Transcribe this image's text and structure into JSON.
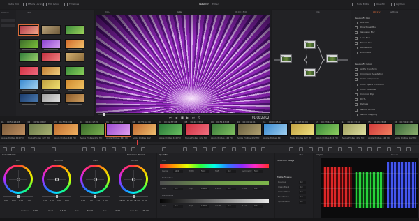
{
  "topbar": {
    "left_menu": [
      "Media Pool",
      "Effects Library",
      "Edit Index",
      "Timelines"
    ],
    "project_title": "Nature",
    "project_status": "Edited",
    "right_menu": [
      "Node Editor",
      "OpenFX",
      "Lightbox"
    ]
  },
  "gallery": {
    "label": "Gallery",
    "stills_label": "Stills"
  },
  "viewer": {
    "zoom": "34%",
    "name": "Color",
    "top_timecode": "01:00:15:08",
    "current_timecode": "01:00:23:02"
  },
  "nodes": {
    "mode_label": "Clip",
    "labels": [
      "01",
      "02",
      "03",
      "04"
    ]
  },
  "library": {
    "tab_label": "Library",
    "settings_label": "Settings",
    "section1_title": "ResolveFX Blur",
    "section1_items": [
      "Box Blur",
      "Directional Blur",
      "Gaussian Blur",
      "Lens Blur",
      "Mosaic Blur",
      "Radial Blur",
      "Zoom Blur"
    ],
    "section2_title": "ResolveFX Color",
    "section2_items": [
      "ACES Transform",
      "Chromatic Adaptation",
      "Color Compressor",
      "Color Space Transform",
      "Color Stabilizer",
      "Contrast Pop",
      "DCTL",
      "Dehaze",
      "Gamut Limiter",
      "Gamut Mapping"
    ]
  },
  "timeline": {
    "clips": [
      {
        "num": "01",
        "tc": "00:50:24:18",
        "name": "Apple ProRes 422 HQ"
      },
      {
        "num": "02",
        "tc": "00:51:08:02",
        "name": "Apple ProRes 422 HQ"
      },
      {
        "num": "03",
        "tc": "05:53:10:02",
        "name": "Apple ProRes 422 HQ"
      },
      {
        "num": "04",
        "tc": "00:04:17:20",
        "name": "Apple ProRes 422 HQ"
      },
      {
        "num": "05",
        "tc": "00:00:06:17",
        "name": "Apple ProRes 422 HQ"
      },
      {
        "num": "06",
        "tc": "00:55:12:10",
        "name": "Apple ProRes 422"
      },
      {
        "num": "07",
        "tc": "00:02:37:08",
        "name": "Apple ProRes 422 HQ"
      },
      {
        "num": "08",
        "tc": "00:46:33:11",
        "name": "Apple ProRes 422 HQ"
      },
      {
        "num": "09",
        "tc": "00:51:47:08",
        "name": "Apple ProRes 422 HQ"
      },
      {
        "num": "10",
        "tc": "00:00:19:01",
        "name": "Apple ProRes 422 HQ"
      },
      {
        "num": "11",
        "tc": "00:09:05:02",
        "name": "Apple ProRes 422"
      },
      {
        "num": "12",
        "tc": "00:07:36:04",
        "name": "Apple ProRes 422 HQ"
      },
      {
        "num": "13",
        "tc": "00:23:44:13",
        "name": "Apple ProRes 422 HQ"
      },
      {
        "num": "14",
        "tc": "00:56:33:19",
        "name": "Apple ProRes 422 HQ"
      },
      {
        "num": "15",
        "tc": "00:03:26:03",
        "name": "Apple ProRes 422 HQ"
      },
      {
        "num": "16",
        "tc": "00:56:41:18",
        "name": "Apple ProRes 422 HQ"
      }
    ]
  },
  "color_wheels": {
    "panel_title": "Color Wheels",
    "mode_label": "Primaries Wheels",
    "wheels": [
      {
        "name": "Lift",
        "values": [
          "0.00",
          "0.00",
          "0.00",
          "0.00"
        ]
      },
      {
        "name": "Gamma",
        "values": [
          "0.00",
          "0.00",
          "0.00",
          "0.00"
        ]
      },
      {
        "name": "Gain",
        "values": [
          "1.00",
          "1.00",
          "1.00",
          "1.00"
        ]
      },
      {
        "name": "Offset",
        "values": [
          "25.00",
          "25.00",
          "25.00",
          "25.00"
        ]
      }
    ],
    "bottom_params": [
      {
        "label": "Contrast",
        "value": "1.000"
      },
      {
        "label": "Pivot",
        "value": "0.435"
      },
      {
        "label": "Sat",
        "value": "50.00"
      },
      {
        "label": "Hue",
        "value": "50.00"
      },
      {
        "label": "Lum Mix",
        "value": "100.00"
      }
    ]
  },
  "qualifier": {
    "title": "Qualifier",
    "hue": {
      "label": "Hue",
      "fields": [
        {
          "k": "Center",
          "v": "50.0"
        },
        {
          "k": "Width",
          "v": "50.0"
        },
        {
          "k": "Soft",
          "v": "0.0"
        },
        {
          "k": "Symmetry",
          "v": "50.0"
        }
      ]
    },
    "sat": {
      "label": "Saturation",
      "fields": [
        {
          "k": "Low",
          "v": "0.0"
        },
        {
          "k": "High",
          "v": "100.0"
        },
        {
          "k": "L.Soft",
          "v": "0.0"
        },
        {
          "k": "H.Soft",
          "v": "0.0"
        }
      ]
    },
    "lum": {
      "label": "Luminance",
      "fields": [
        {
          "k": "Low",
          "v": "0.0"
        },
        {
          "k": "High",
          "v": "100.0"
        },
        {
          "k": "L.Soft",
          "v": "0.0"
        },
        {
          "k": "H.Soft",
          "v": "0.0"
        }
      ]
    }
  },
  "selection": {
    "title": "Selection Range",
    "zoom": "45%",
    "matte_title": "Matte Finesse",
    "rows": [
      {
        "k": "Denoise",
        "v": "0.0"
      },
      {
        "k": "Clean Black",
        "v": "0.0"
      },
      {
        "k": "Clean White",
        "v": "0.0"
      },
      {
        "k": "Blur Radius",
        "v": "0.0"
      },
      {
        "k": "In/Out Ratio",
        "v": "0.0"
      }
    ]
  },
  "scopes": {
    "title": "Scopes",
    "mode": "Parade"
  }
}
